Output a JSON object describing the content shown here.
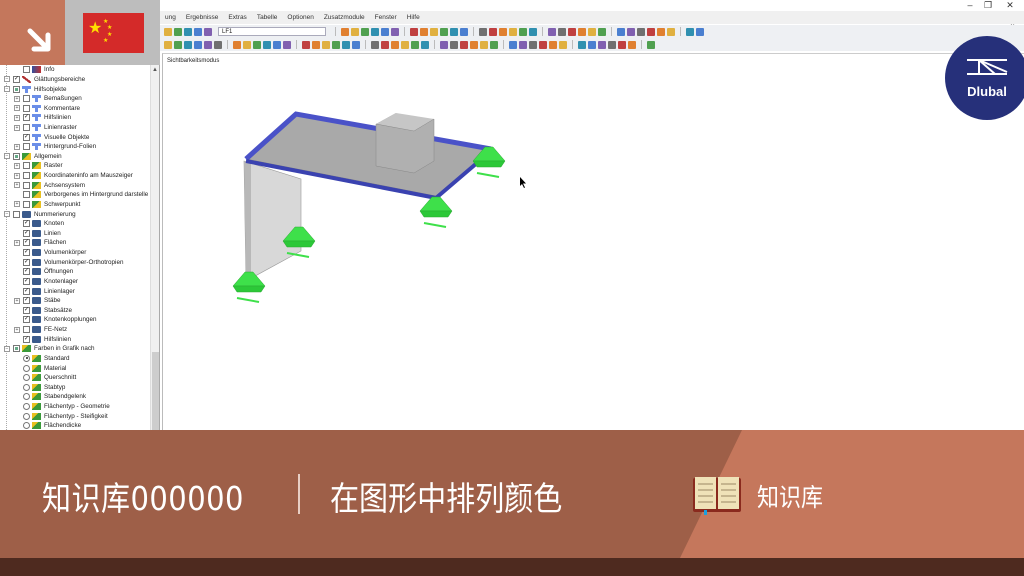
{
  "window": {
    "minimize": "–",
    "restore": "❐",
    "close": "✕",
    "mdi_controls": "_ ▫ ✕"
  },
  "menu": [
    "ung",
    "Ergebnisse",
    "Extras",
    "Tabelle",
    "Optionen",
    "Zusatzmodule",
    "Fenster",
    "Hilfe"
  ],
  "toolbar": {
    "load_case": "LF1"
  },
  "viewport": {
    "label": "Sichtbarkeitsmodus"
  },
  "tree": {
    "items": [
      {
        "label": "Info",
        "level": 2,
        "check": "off",
        "icon": "info",
        "exp": false
      },
      {
        "label": "Glättungsbereiche",
        "level": 1,
        "check": "on",
        "icon": "smooth",
        "exp": true
      },
      {
        "label": "Hilfsobjekte",
        "level": 1,
        "check": "partial",
        "icon": "pin",
        "exp": true
      },
      {
        "label": "Bemaßungen",
        "level": 2,
        "check": "off",
        "icon": "pin",
        "exp": true
      },
      {
        "label": "Kommentare",
        "level": 2,
        "check": "off",
        "icon": "pin",
        "exp": true
      },
      {
        "label": "Hilfslinien",
        "level": 2,
        "check": "on",
        "icon": "pin",
        "exp": true
      },
      {
        "label": "Linienraster",
        "level": 2,
        "check": "off",
        "icon": "pin",
        "exp": true
      },
      {
        "label": "Visuelle Objekte",
        "level": 2,
        "check": "on",
        "icon": "pin",
        "exp": false
      },
      {
        "label": "Hintergrund-Folien",
        "level": 2,
        "check": "off",
        "icon": "pin",
        "exp": true
      },
      {
        "label": "Allgemein",
        "level": 1,
        "check": "partial",
        "icon": "gen",
        "exp": true
      },
      {
        "label": "Raster",
        "level": 2,
        "check": "off",
        "icon": "gen",
        "exp": true
      },
      {
        "label": "Koordinateninfo am Mauszeiger",
        "level": 2,
        "check": "off",
        "icon": "gen",
        "exp": true
      },
      {
        "label": "Achsensystem",
        "level": 2,
        "check": "off",
        "icon": "gen",
        "exp": true
      },
      {
        "label": "Verborgenes im Hintergrund darstelle",
        "level": 2,
        "check": "off",
        "icon": "gen",
        "exp": false
      },
      {
        "label": "Schwerpunkt",
        "level": 2,
        "check": "off",
        "icon": "gen",
        "exp": true
      },
      {
        "label": "Nummerierung",
        "level": 1,
        "check": "off",
        "icon": "num",
        "exp": true
      },
      {
        "label": "Knoten",
        "level": 2,
        "check": "on",
        "icon": "num",
        "exp": false
      },
      {
        "label": "Linien",
        "level": 2,
        "check": "on",
        "icon": "num",
        "exp": false
      },
      {
        "label": "Flächen",
        "level": 2,
        "check": "on",
        "icon": "num",
        "exp": true
      },
      {
        "label": "Volumenkörper",
        "level": 2,
        "check": "on",
        "icon": "num",
        "exp": false
      },
      {
        "label": "Volumenkörper-Orthotropien",
        "level": 2,
        "check": "on",
        "icon": "num",
        "exp": false
      },
      {
        "label": "Öffnungen",
        "level": 2,
        "check": "on",
        "icon": "num",
        "exp": false
      },
      {
        "label": "Knotenlager",
        "level": 2,
        "check": "on",
        "icon": "num",
        "exp": false
      },
      {
        "label": "Linienlager",
        "level": 2,
        "check": "on",
        "icon": "num",
        "exp": false
      },
      {
        "label": "Stäbe",
        "level": 2,
        "check": "on",
        "icon": "num",
        "exp": true
      },
      {
        "label": "Stabsätze",
        "level": 2,
        "check": "on",
        "icon": "num",
        "exp": false
      },
      {
        "label": "Knotenkopplungen",
        "level": 2,
        "check": "on",
        "icon": "num",
        "exp": false
      },
      {
        "label": "FE-Netz",
        "level": 2,
        "check": "off",
        "icon": "num",
        "exp": true
      },
      {
        "label": "Hilfslinien",
        "level": 2,
        "check": "on",
        "icon": "num",
        "exp": false
      },
      {
        "label": "Farben in Grafik nach",
        "level": 1,
        "check": "partial",
        "icon": "color",
        "exp": true
      },
      {
        "label": "Standard",
        "level": 2,
        "check": "radio-on",
        "icon": "color",
        "exp": false
      },
      {
        "label": "Material",
        "level": 2,
        "check": "radio",
        "icon": "color",
        "exp": false
      },
      {
        "label": "Querschnitt",
        "level": 2,
        "check": "radio",
        "icon": "color",
        "exp": false
      },
      {
        "label": "Stabtyp",
        "level": 2,
        "check": "radio",
        "icon": "color",
        "exp": false
      },
      {
        "label": "Stabendgelenk",
        "level": 2,
        "check": "radio",
        "icon": "color",
        "exp": false
      },
      {
        "label": "Flächentyp - Geometrie",
        "level": 2,
        "check": "radio",
        "icon": "color",
        "exp": false
      },
      {
        "label": "Flächentyp - Steifigkeit",
        "level": 2,
        "check": "radio",
        "icon": "color",
        "exp": false
      },
      {
        "label": "Flächendicke",
        "level": 2,
        "check": "radio",
        "icon": "color",
        "exp": false
      }
    ]
  },
  "logo": {
    "text": "Dlubal"
  },
  "banner": {
    "title": "知识库000000",
    "subtitle": "在图形中排列颜色",
    "section": "知识库"
  },
  "colors": {
    "corner": "#c4775c",
    "banner": "#9e5f48",
    "banner_right": "#c5775c",
    "footer": "#4e2a1f",
    "logo": "#26307a",
    "flag": "#d42a29",
    "support": "#3ee04a",
    "slab_edge": "#4a52c8"
  }
}
